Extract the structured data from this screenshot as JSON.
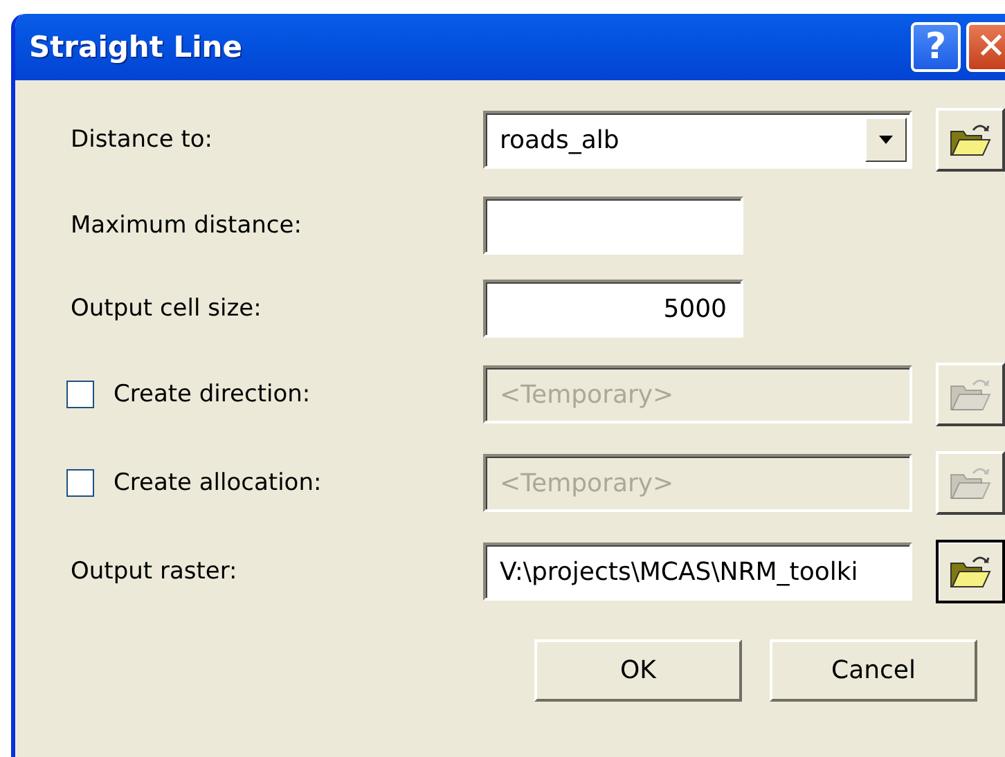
{
  "window": {
    "title": "Straight Line",
    "help": "?",
    "close": "✕"
  },
  "rows": [
    {
      "kind": "combo",
      "label": "Distance to:",
      "value": "roads_alb",
      "disabled": false,
      "browse_focused": false
    },
    {
      "kind": "short",
      "label": "Maximum distance:",
      "value": "",
      "disabled": false
    },
    {
      "kind": "number",
      "label": "Output cell size:",
      "value": "5000",
      "disabled": false
    },
    {
      "kind": "check",
      "label": "Create direction:",
      "checked": false,
      "value": "<Temporary>",
      "disabled": true,
      "browse_focused": false
    },
    {
      "kind": "check",
      "label": "Create allocation:",
      "checked": false,
      "value": "<Temporary>",
      "disabled": true,
      "browse_focused": false
    },
    {
      "kind": "path",
      "label": "Output raster:",
      "value": "V:\\projects\\MCAS\\NRM_toolki",
      "disabled": false,
      "browse_focused": true
    }
  ],
  "buttons": [
    "OK",
    "Cancel"
  ]
}
